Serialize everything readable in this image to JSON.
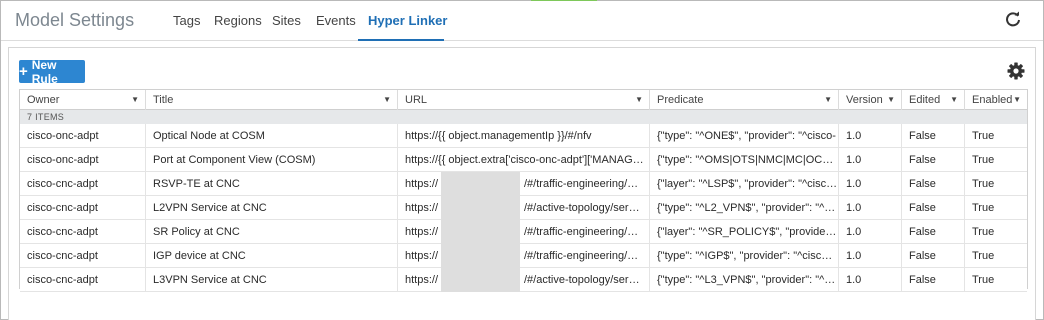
{
  "app": {
    "title": "Model Settings"
  },
  "tabs": [
    {
      "label": "Tags"
    },
    {
      "label": "Regions"
    },
    {
      "label": "Sites"
    },
    {
      "label": "Events"
    },
    {
      "label": "Hyper Linker",
      "active": true
    }
  ],
  "toolbar": {
    "new_rule_label": "New Rule"
  },
  "grid": {
    "columns": [
      "Owner",
      "Title",
      "URL",
      "Predicate",
      "Version",
      "Edited",
      "Enabled"
    ],
    "group_label": "7 ITEMS",
    "rows": [
      {
        "owner": "cisco-onc-adpt",
        "title": "Optical Node at COSM",
        "url_pre": "https://{{ object.managementIp }}/#/nfv",
        "url_post": "",
        "predicate": "{\"type\": \"^ONE$\", \"provider\": \"^cisco-",
        "version": "1.0",
        "edited": "False",
        "enabled": "True"
      },
      {
        "owner": "cisco-onc-adpt",
        "title": "Port at Component View (COSM)",
        "url_pre": "https://{{ object.extra['cisco-onc-adpt']['MANAGEMEN...",
        "url_post": "",
        "predicate": "{\"type\": \"^OMS|OTS|NMC|MC|OCH|OTU...",
        "version": "1.0",
        "edited": "False",
        "enabled": "True"
      },
      {
        "owner": "cisco-cnc-adpt",
        "title": "RSVP-TE at CNC",
        "url_pre": "https://",
        "url_post": "/#/traffic-engineering/pol...",
        "predicate": "{\"layer\": \"^LSP$\", \"provider\": \"^cisco-c...",
        "version": "1.0",
        "edited": "False",
        "enabled": "True"
      },
      {
        "owner": "cisco-cnc-adpt",
        "title": "L2VPN Service at CNC",
        "url_pre": "https://",
        "url_post": "/#/active-topology/servic...",
        "predicate": "{\"type\": \"^L2_VPN$\", \"provider\": \"^cisc...",
        "version": "1.0",
        "edited": "False",
        "enabled": "True"
      },
      {
        "owner": "cisco-cnc-adpt",
        "title": "SR Policy at CNC",
        "url_pre": "https://",
        "url_post": "/#/traffic-engineering/pol...",
        "predicate": "{\"layer\": \"^SR_POLICY$\", \"provider\": \"...",
        "version": "1.0",
        "edited": "False",
        "enabled": "True"
      },
      {
        "owner": "cisco-cnc-adpt",
        "title": "IGP device at CNC",
        "url_pre": "https://",
        "url_post": "/#/traffic-engineering/de...",
        "predicate": "{\"type\": \"^IGP$\", \"provider\": \"^cisco-c...",
        "version": "1.0",
        "edited": "False",
        "enabled": "True"
      },
      {
        "owner": "cisco-cnc-adpt",
        "title": "L3VPN Service at CNC",
        "url_pre": "https://",
        "url_post": "/#/active-topology/servic...",
        "predicate": "{\"type\": \"^L3_VPN$\", \"provider\": \"^cisc...",
        "version": "1.0",
        "edited": "False",
        "enabled": "True"
      }
    ]
  },
  "colors": {
    "accent": "#1f6fb5",
    "button": "#2d86d1",
    "top_indicator": "#7ec85a"
  },
  "icons": {
    "refresh": "refresh-icon",
    "settings": "gear-icon",
    "sort": "caret-down-icon",
    "add": "plus-icon"
  }
}
